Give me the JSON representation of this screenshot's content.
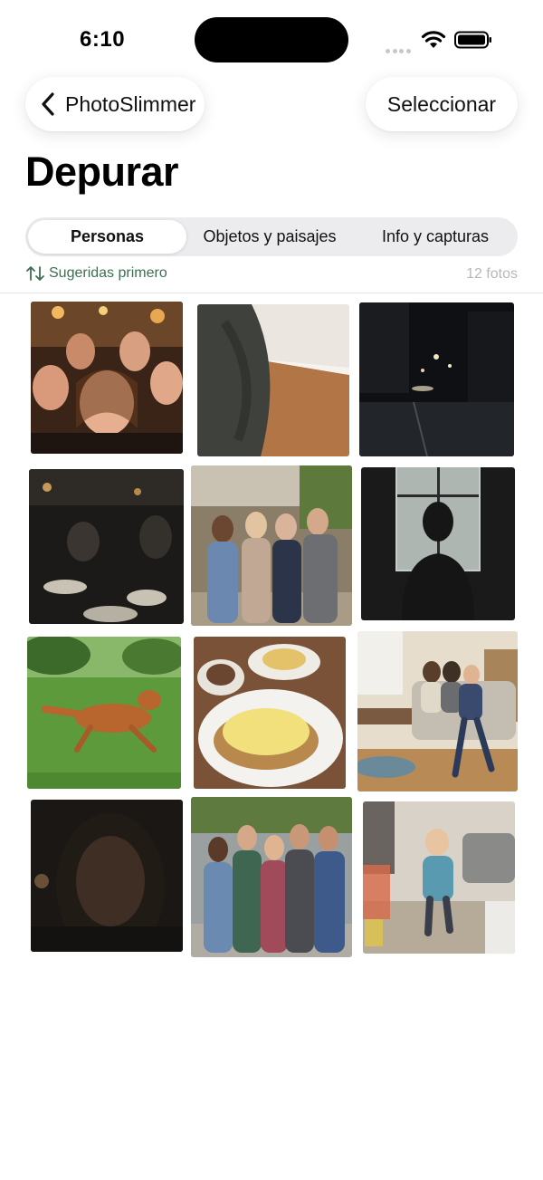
{
  "status_bar": {
    "time": "6:10"
  },
  "nav": {
    "back_label": "PhotoSlimmer",
    "select_label": "Seleccionar"
  },
  "page": {
    "title": "Depurar"
  },
  "tabs": [
    {
      "label": "Personas",
      "selected": true
    },
    {
      "label": "Objetos y paisajes",
      "selected": false
    },
    {
      "label": "Info y capturas",
      "selected": false
    }
  ],
  "sort": {
    "label": "Sugeridas primero"
  },
  "photo_count": "12 fotos",
  "colors": {
    "accent_green": "#3d6e52",
    "segment_bg": "#ececef",
    "muted_text": "#b8b8bc"
  },
  "photos": [
    {
      "subject": "group selfie in bar"
    },
    {
      "subject": "blurry wall and floor"
    },
    {
      "subject": "night street"
    },
    {
      "subject": "dark restaurant"
    },
    {
      "subject": "four friends outdoors"
    },
    {
      "subject": "silhouette at window"
    },
    {
      "subject": "dog running on grass"
    },
    {
      "subject": "breakfast plate"
    },
    {
      "subject": "family in living room"
    },
    {
      "subject": "dark selfie"
    },
    {
      "subject": "five friends in park"
    },
    {
      "subject": "blurry child playing"
    }
  ]
}
